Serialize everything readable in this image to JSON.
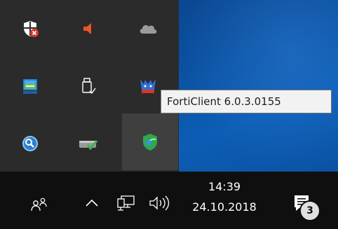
{
  "tooltip": {
    "text": "FortiClient 6.0.3.0155"
  },
  "tray_overflow": {
    "icons": [
      {
        "name": "windows-security-shield-icon",
        "status": "alert"
      },
      {
        "name": "speaker-muted-icon"
      },
      {
        "name": "onedrive-cloud-icon"
      },
      {
        "name": "virtual-machine-monitor-icon"
      },
      {
        "name": "usb-safely-remove-icon"
      },
      {
        "name": "horned-app-icon"
      },
      {
        "name": "globe-search-icon"
      },
      {
        "name": "drive-check-icon"
      },
      {
        "name": "forticlient-shield-icon",
        "hovered": true
      }
    ]
  },
  "taskbar": {
    "clock": {
      "time": "14:39",
      "date": "24.10.2018"
    },
    "notifications": {
      "count": "3"
    },
    "icons": {
      "people": "people-icon",
      "chevron": "chevron-up-icon",
      "network": "network-icon",
      "volume": "volume-icon",
      "action_center": "action-center-icon"
    }
  },
  "colors": {
    "panel_bg": "#2b2b2b",
    "taskbar_bg": "#0f0f0f",
    "desktop_accent": "#0b4f9e",
    "forticlient_green": "#2eaa4a",
    "security_red": "#d9362b",
    "speaker_orange": "#e8562a"
  }
}
